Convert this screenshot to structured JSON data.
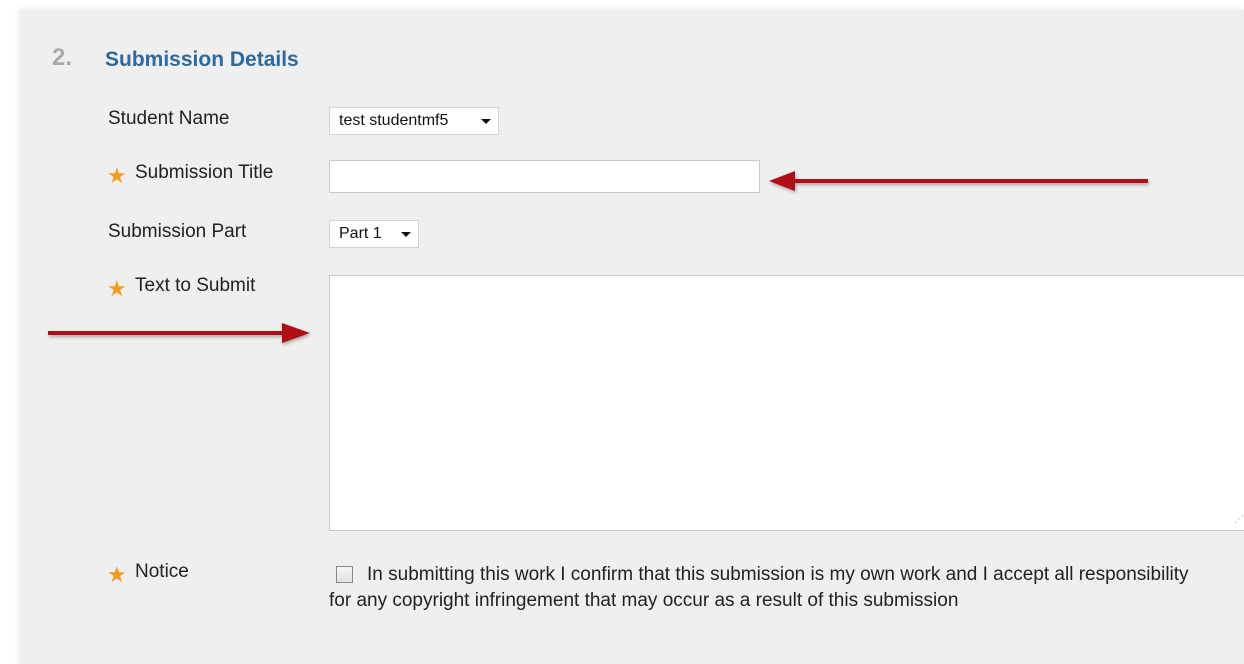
{
  "section": {
    "number": "2.",
    "title": "Submission Details"
  },
  "fields": {
    "student_name": {
      "label": "Student Name",
      "selected": "test studentmf5"
    },
    "submission_title": {
      "label": "Submission Title",
      "value": "",
      "required": true
    },
    "submission_part": {
      "label": "Submission Part",
      "selected": "Part 1"
    },
    "text_to_submit": {
      "label": "Text to Submit",
      "value": "",
      "required": true
    },
    "notice": {
      "label": "Notice",
      "text": "In submitting this work I confirm that this submission is my own work and I accept all responsibility for any copyright infringement that may occur as a result of this submission",
      "checked": false,
      "required": true
    }
  },
  "required_marker": "★",
  "annotations": [
    {
      "name": "annotation-arrow-title",
      "points_to": "submission_title",
      "direction": "left"
    },
    {
      "name": "annotation-arrow-text",
      "points_to": "text_to_submit",
      "direction": "right"
    }
  ],
  "colors": {
    "panel_background": "#efefef",
    "section_title": "#2c6aa0",
    "step_number": "#a9a9a9",
    "required_star": "#f39c1f",
    "annotation_arrow": "#b01116"
  }
}
